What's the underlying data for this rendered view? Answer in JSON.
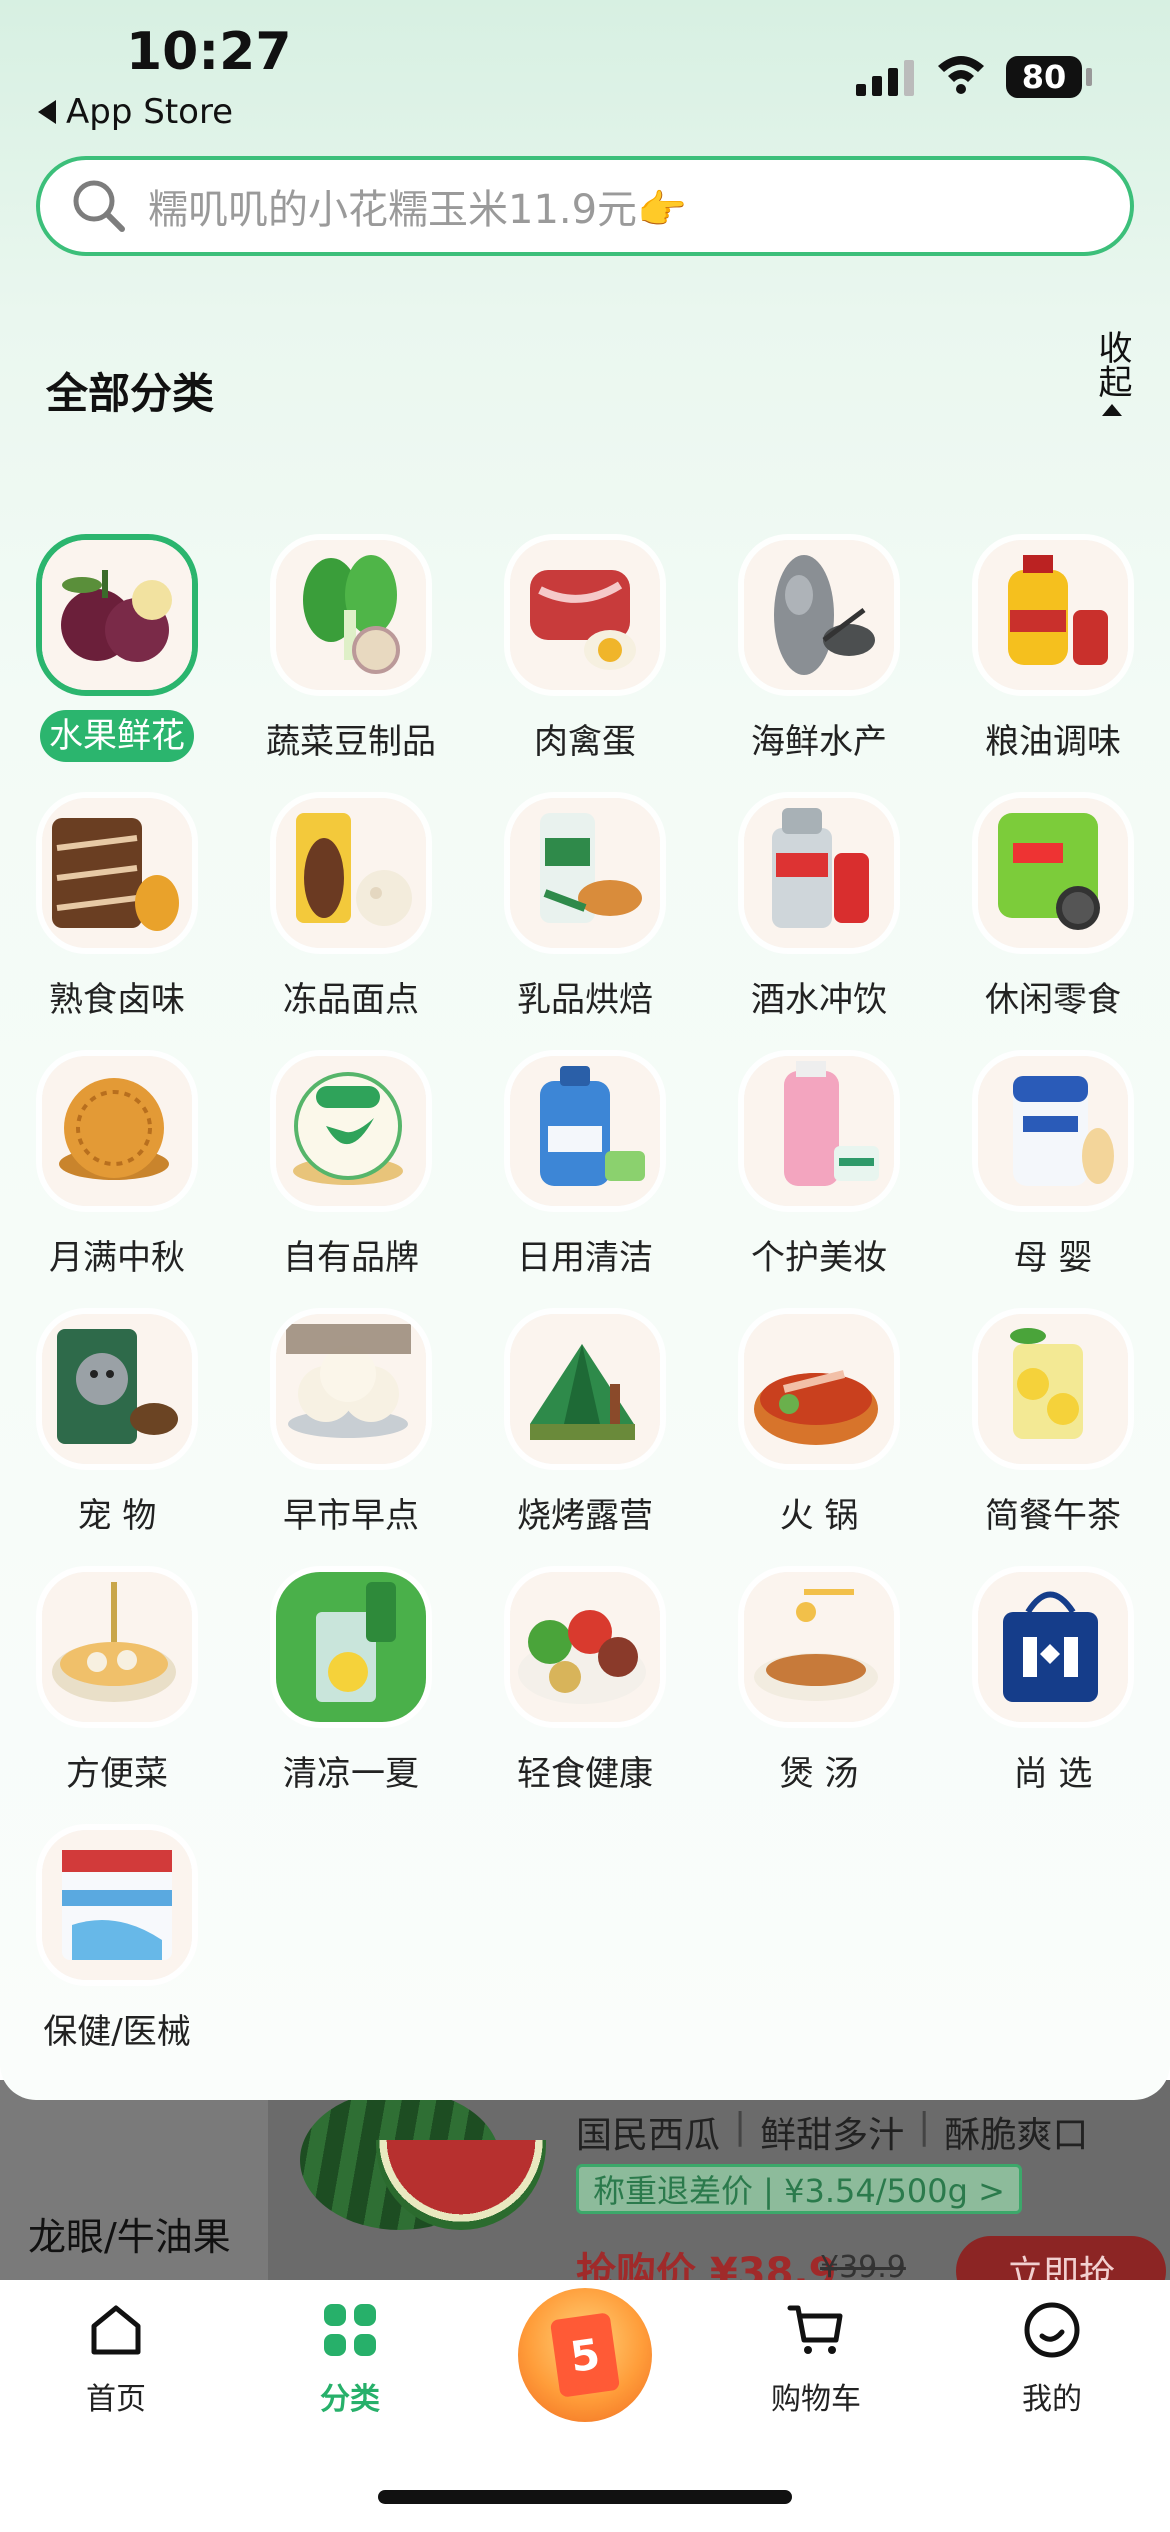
{
  "status_bar": {
    "time": "10:27",
    "back_label": "App Store",
    "battery": "80"
  },
  "search": {
    "placeholder": "糯叽叽的小花糯玉米11.9元👉"
  },
  "categories_panel": {
    "title": "全部分类",
    "collapse_label": "收起",
    "items": [
      {
        "label": "水果鲜花",
        "selected": true,
        "icon": "fruit-flower-icon"
      },
      {
        "label": "蔬菜豆制品",
        "icon": "vegetable-icon"
      },
      {
        "label": "肉禽蛋",
        "icon": "meat-egg-icon"
      },
      {
        "label": "海鲜水产",
        "icon": "seafood-icon"
      },
      {
        "label": "粮油调味",
        "icon": "grain-oil-icon"
      },
      {
        "label": "熟食卤味",
        "icon": "deli-icon"
      },
      {
        "label": "冻品面点",
        "icon": "frozen-icon"
      },
      {
        "label": "乳品烘焙",
        "icon": "dairy-bakery-icon"
      },
      {
        "label": "酒水冲饮",
        "icon": "drinks-icon"
      },
      {
        "label": "休闲零食",
        "icon": "snacks-icon"
      },
      {
        "label": "月满中秋",
        "icon": "mooncake-icon"
      },
      {
        "label": "自有品牌",
        "icon": "own-brand-icon"
      },
      {
        "label": "日用清洁",
        "icon": "cleaning-icon"
      },
      {
        "label": "个护美妆",
        "icon": "beauty-icon"
      },
      {
        "label": "母  婴",
        "icon": "baby-icon"
      },
      {
        "label": "宠  物",
        "icon": "pet-icon"
      },
      {
        "label": "早市早点",
        "icon": "breakfast-icon"
      },
      {
        "label": "烧烤露营",
        "icon": "camping-icon"
      },
      {
        "label": "火  锅",
        "icon": "hotpot-icon"
      },
      {
        "label": "简餐午茶",
        "icon": "tea-icon"
      },
      {
        "label": "方便菜",
        "icon": "convenience-dish-icon"
      },
      {
        "label": "清凉一夏",
        "icon": "summer-drink-icon"
      },
      {
        "label": "轻食健康",
        "icon": "healthy-food-icon"
      },
      {
        "label": "煲  汤",
        "icon": "soup-icon"
      },
      {
        "label": "尚  选",
        "icon": "shangxuan-bag-icon"
      },
      {
        "label": "保健/医械",
        "icon": "medical-icon"
      }
    ]
  },
  "background_content": {
    "left_category": "龙眼/牛油果",
    "tags": [
      "国民西瓜",
      "鲜甜多汁",
      "酥脆爽口"
    ],
    "price_note": "称重退差价 | ¥3.54/500g >",
    "buy_price": "抢购价 ¥38.9",
    "old_price": "¥39.9",
    "buy_button": "立即抢"
  },
  "tabbar": {
    "items": [
      {
        "label": "首页",
        "icon": "home-icon"
      },
      {
        "label": "分类",
        "icon": "category-icon",
        "active": true
      },
      {
        "label": "5",
        "icon": "promo-icon"
      },
      {
        "label": "购物车",
        "icon": "cart-icon"
      },
      {
        "label": "我的",
        "icon": "profile-icon"
      }
    ]
  },
  "colors": {
    "accent": "#2bb56e",
    "search_border": "#3cbf7a"
  }
}
